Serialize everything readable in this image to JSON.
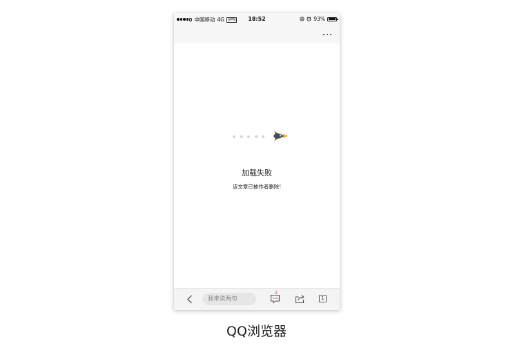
{
  "status_bar": {
    "carrier": "中国移动",
    "network": "4G",
    "vpn": "VPN",
    "time": "18:52",
    "battery": "93%",
    "battery_level": 0.93
  },
  "nav_bar": {
    "more_icon": "more-horizontal-icon"
  },
  "error": {
    "title": "加载失败",
    "message": "该文章已被作者删除!",
    "illustration": "rocket-icon"
  },
  "toolbar": {
    "comment_placeholder": "我来说两句",
    "comment_count": "2",
    "tab_count": "1"
  },
  "caption": "QQ浏览器",
  "colors": {
    "accent": "#f5a623",
    "badge": "#e53935",
    "rocket": "#4a4a4a"
  }
}
